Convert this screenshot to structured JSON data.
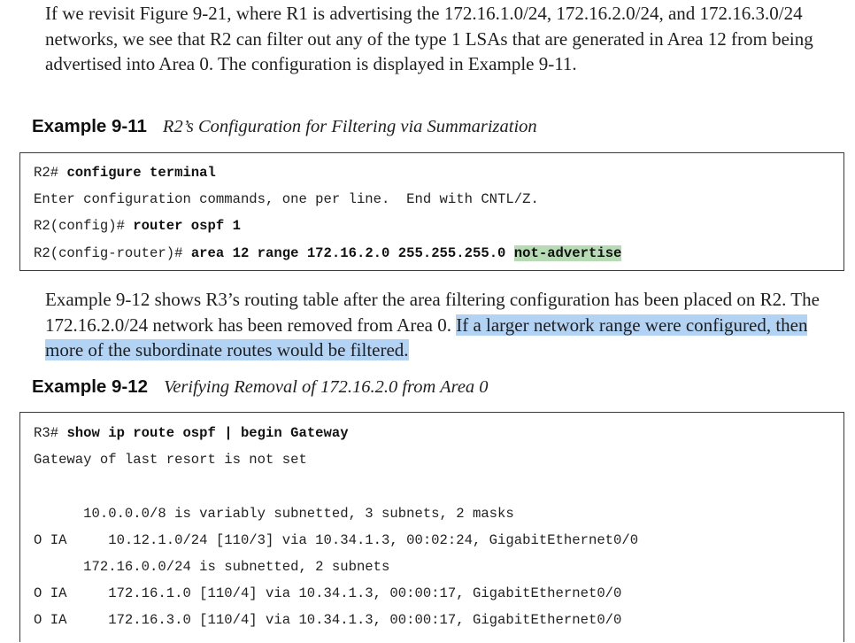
{
  "intro_paragraph": "If we revisit Figure 9-21, where R1 is advertising the 172.16.1.0/24, 172.16.2.0/24, and 172.16.3.0/24 networks, we see that R2 can filter out any of the type 1 LSAs that are generated in Area 12 from being advertised into Area 0. The configuration is displayed in Example 9-11.",
  "example_11": {
    "number": "Example 9-11",
    "title": "R2’s Configuration for Filtering via Summarization",
    "lines": [
      {
        "prompt": "R2# ",
        "command": "configure terminal"
      },
      {
        "text": "Enter configuration commands, one per line.  End with CNTL/Z."
      },
      {
        "prompt": "R2(config)# ",
        "command": "router ospf 1"
      },
      {
        "prompt": "R2(config-router)# ",
        "command": "area 12 range 172.16.2.0 255.255.255.0 ",
        "command_highlighted": "not-advertise"
      }
    ]
  },
  "middle_paragraph": {
    "text": "Example 9-12 shows R3’s routing table after the area filtering configuration has been placed on R2. The 172.16.2.0/24 network has been removed from Area 0. ",
    "highlighted": "If a larger network range were configured, then more of the subordinate routes would be filtered."
  },
  "example_12": {
    "number": "Example 9-12",
    "title": "Verifying Removal of 172.16.2.0 from Area 0",
    "lines": [
      {
        "prompt": "R3# ",
        "command": "show ip route ospf | begin Gateway"
      },
      {
        "text": "Gateway of last resort is not set"
      },
      {
        "text": ""
      },
      {
        "text": "      10.0.0.0/8 is variably subnetted, 3 subnets, 2 masks"
      },
      {
        "text": "O IA     10.12.1.0/24 [110/3] via 10.34.1.3, 00:02:24, GigabitEthernet0/0"
      },
      {
        "text": "      172.16.0.0/24 is subnetted, 2 subnets"
      },
      {
        "text": "O IA     172.16.1.0 [110/4] via 10.34.1.3, 00:00:17, GigabitEthernet0/0"
      },
      {
        "text": "O IA     172.16.3.0 [110/4] via 10.34.1.3, 00:00:17, GigabitEthernet0/0"
      }
    ]
  },
  "highlight_colors": {
    "green": "#b7dcb5",
    "blue": "#b3d3f5"
  }
}
